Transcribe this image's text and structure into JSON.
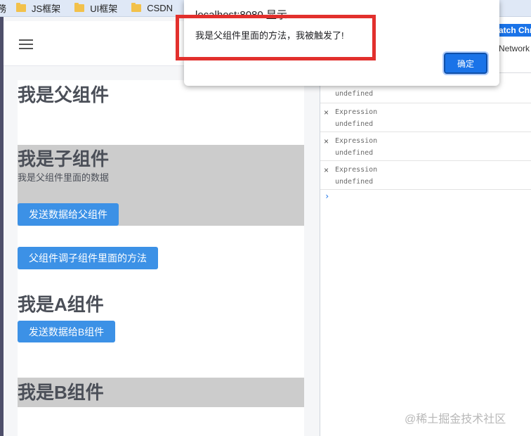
{
  "bookmarks": {
    "partial_first": "務",
    "items": [
      "JS框架",
      "UI框架",
      "CSDN"
    ]
  },
  "app": {
    "parent_title": "我是父组件",
    "child_title": "我是子组件",
    "child_data_text": "我是父组件里面的数据",
    "send_to_parent_button": "发送数据给父组件",
    "call_child_method_button": "父组件调子组件里面的方法",
    "a_title": "我是A组件",
    "send_to_b_button": "发送数据给B组件",
    "b_title": "我是B组件"
  },
  "devtools": {
    "watch_button": "atch Chro",
    "network_tab": "Network",
    "expressions": [
      {
        "label": "",
        "value": "undefined"
      },
      {
        "label": "Expression",
        "value": "undefined"
      },
      {
        "label": "Expression",
        "value": "undefined"
      },
      {
        "label": "Expression",
        "value": "undefined"
      }
    ],
    "prompt_symbol": "›",
    "close_symbol": "×"
  },
  "dialog": {
    "title": "localhost:8080 显示",
    "message": "我是父组件里面的方法，我被触发了!",
    "ok_button": "确定"
  },
  "watermark": "@稀土掘金技术社区",
  "colors": {
    "button_blue": "#3c91e6",
    "highlight_red": "#e2302d",
    "gray_box": "#cccccc"
  }
}
